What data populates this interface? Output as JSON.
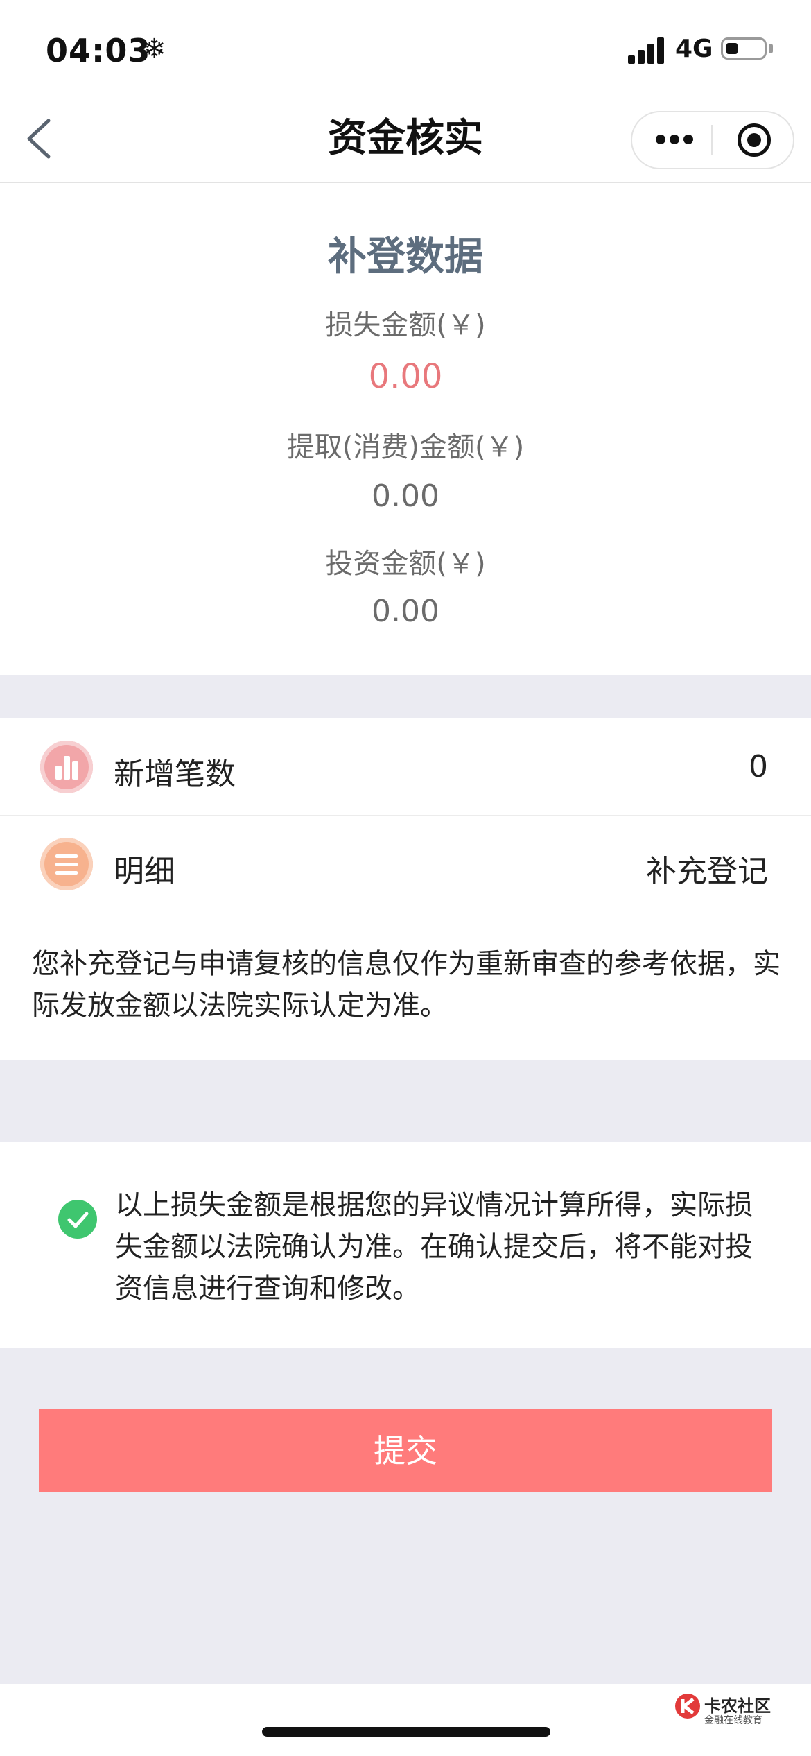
{
  "status_bar": {
    "time": "04:03",
    "weather_glyph": "❄",
    "network": "4G",
    "icons": [
      "snowflake-icon",
      "signal-icon",
      "battery-icon"
    ]
  },
  "nav": {
    "title": "资金核实",
    "icons": [
      "back-chevron-icon",
      "more-dots-icon",
      "close-target-icon"
    ]
  },
  "summary": {
    "title": "补登数据",
    "loss_label": "损失金额(￥)",
    "loss_value": "0.00",
    "withdraw_label": "提取(消费)金额(￥)",
    "withdraw_value": "0.00",
    "invest_label": "投资金额(￥)",
    "invest_value": "0.00"
  },
  "rows": [
    {
      "label": "新增笔数",
      "value": "0",
      "icon": "bar-chart-icon"
    },
    {
      "label": "明细",
      "value": "补充登记",
      "icon": "list-icon"
    }
  ],
  "notice": "您补充登记与申请复核的信息仅作为重新审查的参考依据，实际发放金额以法院实际认定为准。",
  "agreement": {
    "text": "以上损失金额是根据您的异议情况计算所得，实际损失金额以法院确认为准。在确认提交后，将不能对投资信息进行查询和修改。",
    "checked": true,
    "icon": "check-circle-icon"
  },
  "submit_label": "提交",
  "watermark": {
    "title": "卡农社区",
    "subtitle": "金融在线教育"
  },
  "colors": {
    "accent_red": "#ff7b7b",
    "value_red": "#e8787c",
    "check_green": "#3fc66f",
    "title_slate": "#5d6d7e",
    "page_bg": "#ebebf2"
  }
}
